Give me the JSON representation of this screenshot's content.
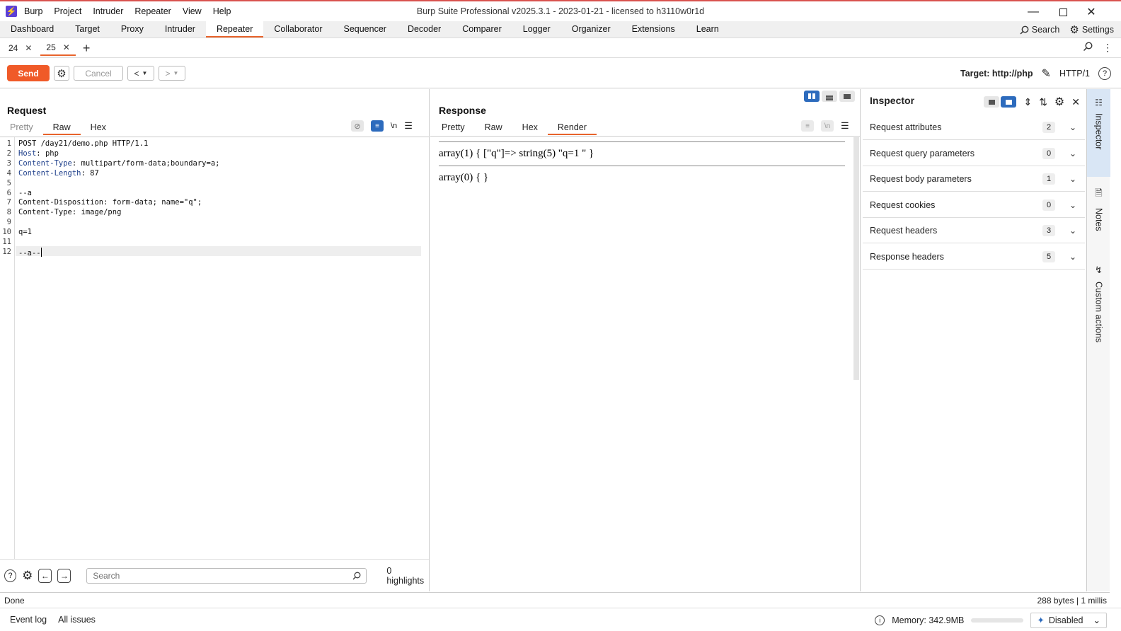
{
  "app": {
    "logo": "⚡",
    "title": "Burp Suite Professional v2025.3.1 - 2023-01-21 - licensed to h3110w0r1d",
    "menu": [
      "Burp",
      "Project",
      "Intruder",
      "Repeater",
      "View",
      "Help"
    ]
  },
  "main_tabs": [
    "Dashboard",
    "Target",
    "Proxy",
    "Intruder",
    "Repeater",
    "Collaborator",
    "Sequencer",
    "Decoder",
    "Comparer",
    "Logger",
    "Organizer",
    "Extensions",
    "Learn"
  ],
  "active_main_tab": "Repeater",
  "top_actions": {
    "search": "Search",
    "settings": "Settings"
  },
  "repeater_tabs": [
    {
      "label": "24",
      "active": false
    },
    {
      "label": "25",
      "active": true
    }
  ],
  "toolbar": {
    "send": "Send",
    "cancel": "Cancel",
    "target": "Target: http://php",
    "protocol": "HTTP/1"
  },
  "request": {
    "title": "Request",
    "tabs": [
      "Pretty",
      "Raw",
      "Hex"
    ],
    "active_tab": "Raw",
    "lines": [
      {
        "n": "1",
        "key": "",
        "text": "POST /day21/demo.php HTTP/1.1"
      },
      {
        "n": "2",
        "key": "Host",
        "text": ": php"
      },
      {
        "n": "3",
        "key": "Content-Type",
        "text": ": multipart/form-data;boundary=a;"
      },
      {
        "n": "4",
        "key": "Content-Length",
        "text": ": 87"
      },
      {
        "n": "5",
        "key": "",
        "text": ""
      },
      {
        "n": "6",
        "key": "",
        "text": "--a"
      },
      {
        "n": "7",
        "key": "",
        "text": "Content-Disposition: form-data; name=\"q\";"
      },
      {
        "n": "8",
        "key": "",
        "text": "Content-Type: image/png"
      },
      {
        "n": "9",
        "key": "",
        "text": ""
      },
      {
        "n": "10",
        "key": "",
        "text": "q=1"
      },
      {
        "n": "11",
        "key": "",
        "text": ""
      },
      {
        "n": "12",
        "key": "",
        "text": "--a--"
      }
    ],
    "search_placeholder": "Search",
    "highlights": "0 highlights"
  },
  "response": {
    "title": "Response",
    "tabs": [
      "Pretty",
      "Raw",
      "Hex",
      "Render"
    ],
    "active_tab": "Render",
    "render_lines": [
      "array(1) { [\"q\"]=> string(5) \"q=1 \" }",
      "array(0) { }"
    ]
  },
  "inspector": {
    "title": "Inspector",
    "sections": [
      {
        "label": "Request attributes",
        "count": "2"
      },
      {
        "label": "Request query parameters",
        "count": "0"
      },
      {
        "label": "Request body parameters",
        "count": "1"
      },
      {
        "label": "Request cookies",
        "count": "0"
      },
      {
        "label": "Request headers",
        "count": "3"
      },
      {
        "label": "Response headers",
        "count": "5"
      }
    ]
  },
  "side_rail": [
    "Inspector",
    "Notes",
    "Custom actions"
  ],
  "status": {
    "left": "Done",
    "right": "288 bytes | 1 millis"
  },
  "bottom": {
    "event_log": "Event log",
    "all_issues": "All issues",
    "memory": "Memory: 342.9MB",
    "ai": "Disabled"
  },
  "colors": {
    "accent": "#e8632b",
    "send": "#f05a28",
    "selected": "#2d6bbd",
    "header_key": "#1d3e8a"
  }
}
